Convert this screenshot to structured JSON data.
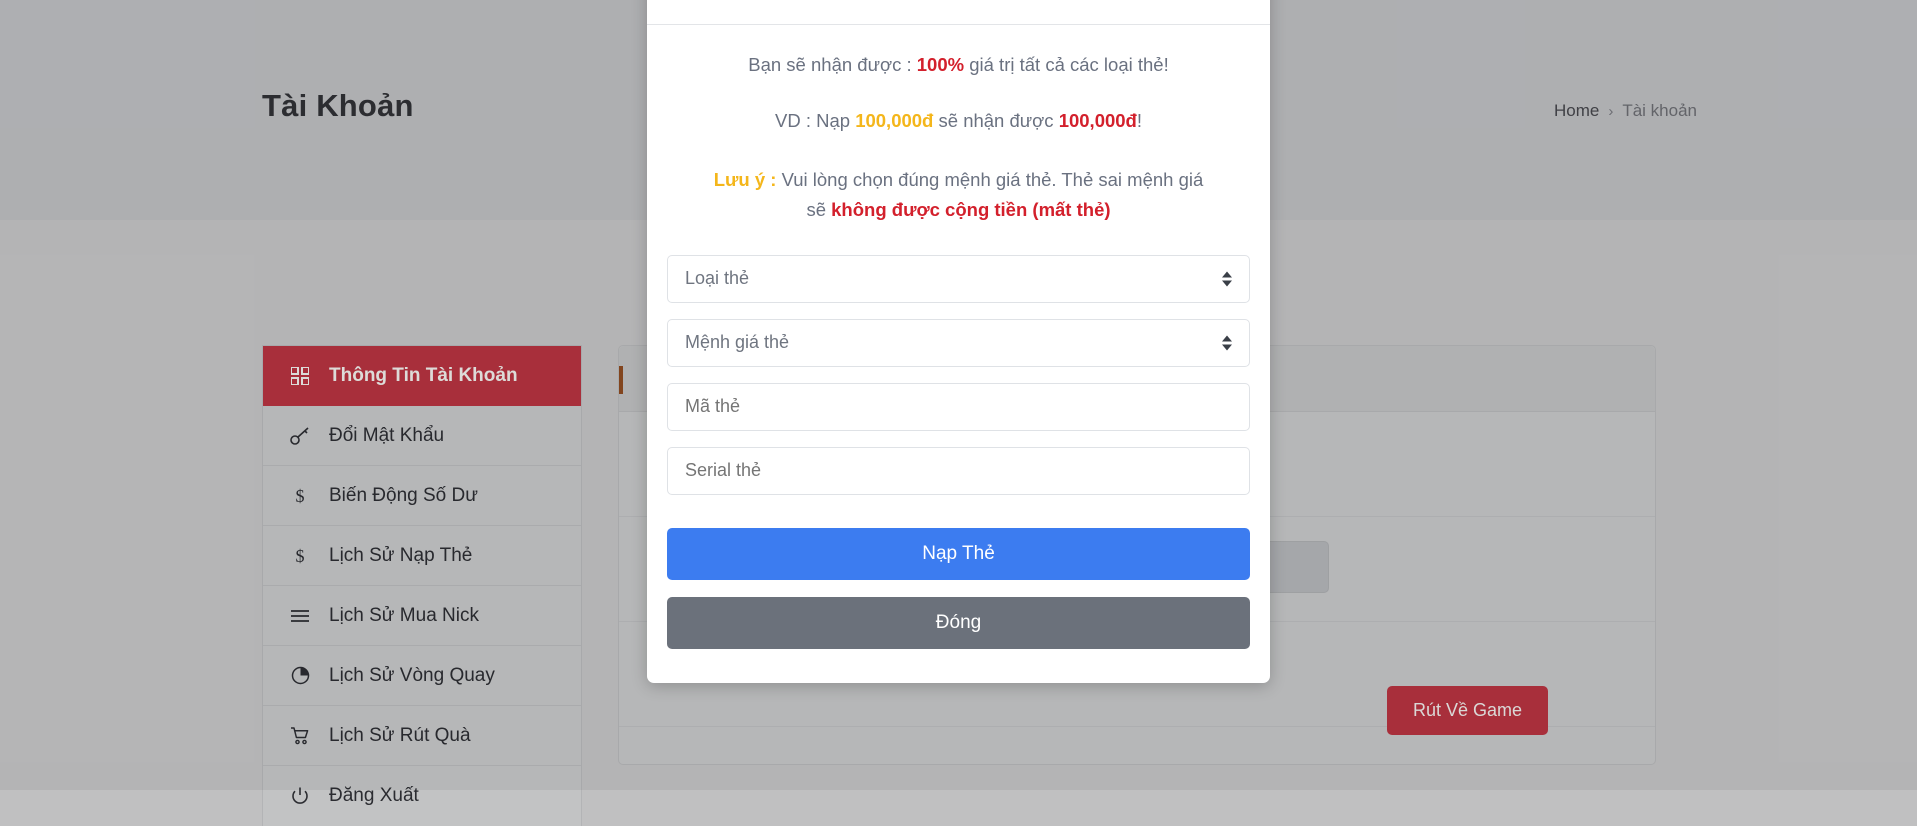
{
  "page": {
    "title": "Tài Khoản",
    "breadcrumb": {
      "home": "Home",
      "separator": "›",
      "current": "Tài khoản"
    }
  },
  "sidebar": {
    "items": [
      {
        "label": "Thông Tin Tài Khoản",
        "icon": "grid-icon",
        "active": true
      },
      {
        "label": "Đổi Mật Khẩu",
        "icon": "key-icon",
        "active": false
      },
      {
        "label": "Biến Động Số Dư",
        "icon": "dollar-sign-icon",
        "active": false
      },
      {
        "label": "Lịch Sử Nạp Thẻ",
        "icon": "dollar-sign-icon",
        "active": false
      },
      {
        "label": "Lịch Sử Mua Nick",
        "icon": "bars-icon",
        "active": false
      },
      {
        "label": "Lịch Sử Vòng Quay",
        "icon": "pie-chart-icon",
        "active": false
      },
      {
        "label": "Lịch Sử Rút Quà",
        "icon": "shopping-cart-icon",
        "active": false
      },
      {
        "label": "Đăng Xuất",
        "icon": "power-icon",
        "active": false
      }
    ]
  },
  "content": {
    "withdraw_button_label": "Rút Về Game"
  },
  "modal": {
    "promo": {
      "line1_prefix": "Bạn sẽ nhận được : ",
      "line1_percent": "100%",
      "line1_suffix": " giá trị tất cả các loại thẻ!",
      "line2_prefix": "VD : Nạp ",
      "line2_amount_in": "100,000đ",
      "line2_middle": " sẽ nhận được ",
      "line2_amount_out": "100,000đ",
      "line2_suffix": "!"
    },
    "note": {
      "label": "Lưu ý :",
      "text": " Vui lòng chọn đúng mệnh giá thẻ. Thẻ sai mệnh giá",
      "tail_prefix": "sẽ ",
      "tail_strong": "không được cộng tiền (mất thẻ)"
    },
    "fields": {
      "card_type": {
        "placeholder": "Loại thẻ",
        "value": ""
      },
      "card_value": {
        "placeholder": "Mệnh giá thẻ",
        "value": ""
      },
      "card_code": {
        "placeholder": "Mã thẻ",
        "value": ""
      },
      "card_serial": {
        "placeholder": "Serial thẻ",
        "value": ""
      }
    },
    "buttons": {
      "submit": "Nạp Thẻ",
      "close": "Đóng"
    }
  },
  "colors": {
    "brand_red": "#b3323f",
    "primary_blue": "#3c7cf0",
    "secondary_gray": "#6b717b",
    "amber": "#f4b61b",
    "danger_red": "#d3202c"
  }
}
